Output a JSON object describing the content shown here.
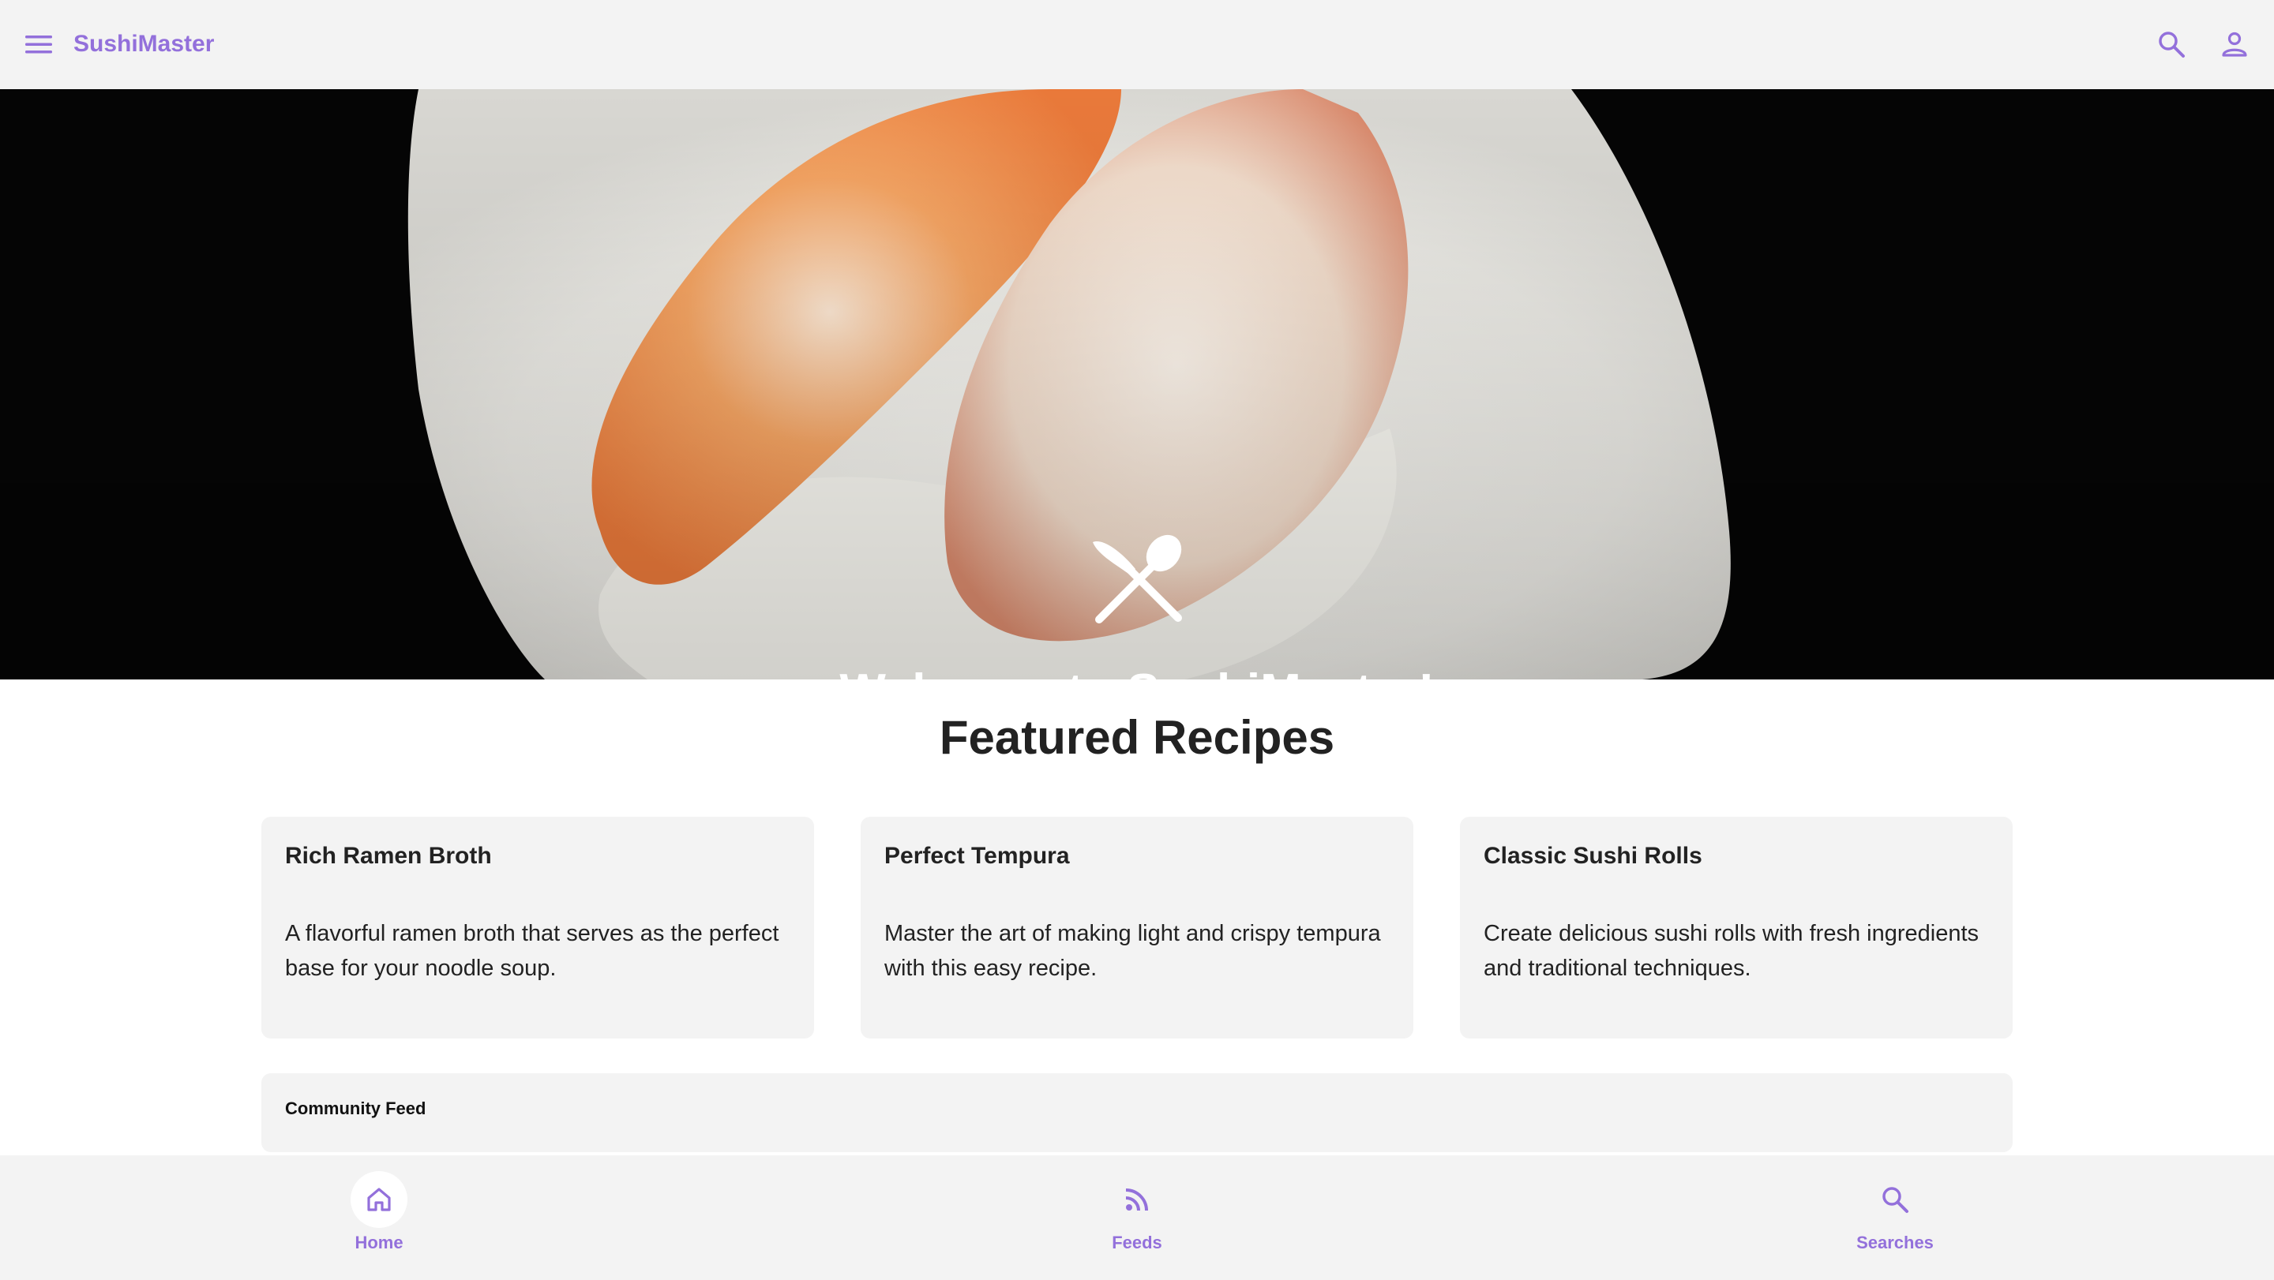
{
  "app": {
    "title": "SushiMaster"
  },
  "header": {
    "menu_icon": "menu-icon",
    "search_icon": "search-icon",
    "account_icon": "person-icon"
  },
  "hero": {
    "welcome_text": "Welcome to SushiMaster!",
    "icon": "fork-spoon-icon"
  },
  "featured": {
    "title": "Featured Recipes",
    "cards": [
      {
        "title": "Rich Ramen Broth",
        "description": "A flavorful ramen broth that serves as the perfect base for your noodle soup."
      },
      {
        "title": "Perfect Tempura",
        "description": "Master the art of making light and crispy tempura with this easy recipe."
      },
      {
        "title": "Classic Sushi Rolls",
        "description": "Create delicious sushi rolls with fresh ingredients and traditional techniques."
      }
    ]
  },
  "community": {
    "title": "Community Feed"
  },
  "bottom_nav": {
    "items": [
      {
        "label": "Home",
        "icon": "home-icon",
        "active": true
      },
      {
        "label": "Feeds",
        "icon": "rss-feed-icon",
        "active": false
      },
      {
        "label": "Searches",
        "icon": "search-icon",
        "active": false
      }
    ]
  },
  "colors": {
    "accent": "#9370db",
    "bar_background": "#f3f3f3",
    "hero_background": "#050505",
    "text": "#222222"
  }
}
